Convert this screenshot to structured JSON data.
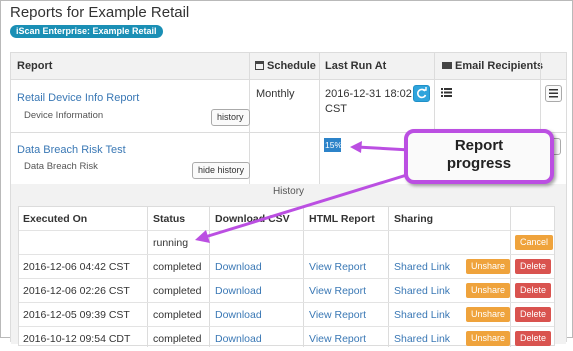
{
  "page": {
    "title": "Reports for Example Retail",
    "badge": "iScan Enterprise: Example Retail"
  },
  "table": {
    "headers": {
      "report": "Report",
      "schedule": "Schedule",
      "last_run": "Last Run At",
      "email": "Email Recipients"
    },
    "rows": [
      {
        "name": "Retail Device Info Report",
        "subtitle": "Device Information",
        "history_button": "history",
        "schedule": "Monthly",
        "last_run_line1": "2016-12-31 18:02",
        "last_run_line2": "CST"
      },
      {
        "name": "Data Breach Risk Test",
        "subtitle": "Data Breach Risk",
        "history_button": "hide history",
        "schedule": "",
        "progress": {
          "label": "15%",
          "value": 0.15
        }
      }
    ]
  },
  "history": {
    "title": "History",
    "headers": {
      "executed_on": "Executed On",
      "status": "Status",
      "download_csv": "Download CSV",
      "html_report": "HTML Report",
      "sharing": "Sharing"
    },
    "rows": [
      {
        "executed_on": "",
        "status": "running",
        "download": "",
        "html": "",
        "sharing": "",
        "action": "Cancel"
      },
      {
        "executed_on": "2016-12-06 04:42 CST",
        "status": "completed",
        "download": "Download",
        "html": "View Report",
        "sharing": "Shared Link",
        "unshare": "Unshare",
        "delete": "Delete"
      },
      {
        "executed_on": "2016-12-06 02:26 CST",
        "status": "completed",
        "download": "Download",
        "html": "View Report",
        "sharing": "Shared Link",
        "unshare": "Unshare",
        "delete": "Delete"
      },
      {
        "executed_on": "2016-12-05 09:39 CST",
        "status": "completed",
        "download": "Download",
        "html": "View Report",
        "sharing": "Shared Link",
        "unshare": "Unshare",
        "delete": "Delete"
      },
      {
        "executed_on": "2016-10-12 09:54 CDT",
        "status": "completed",
        "download": "Download",
        "html": "View Report",
        "sharing": "Shared Link",
        "unshare": "Unshare",
        "delete": "Delete"
      }
    ]
  },
  "callout": {
    "line1": "Report",
    "line2": "progress"
  },
  "colors": {
    "accent": "#1a8fb5",
    "link": "#3a78b5",
    "warning": "#efa33c",
    "danger": "#d9534f",
    "callout_border": "#bb4fe2",
    "progress": "#2c83c9"
  },
  "icons": {
    "schedule": "calendar-icon",
    "email": "envelope-icon",
    "refresh": "refresh-icon",
    "list": "list-icon",
    "detail": "detail-icon"
  }
}
